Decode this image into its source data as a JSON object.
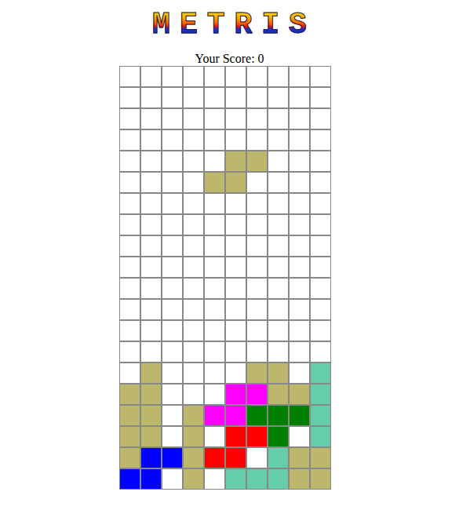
{
  "logo": {
    "title": "METRIS"
  },
  "score": {
    "label": "Your Score:",
    "value": "0"
  },
  "board": {
    "rows": [
      [
        null,
        null,
        null,
        null,
        null,
        null,
        null,
        null,
        null,
        null
      ],
      [
        null,
        null,
        null,
        null,
        null,
        null,
        null,
        null,
        null,
        null
      ],
      [
        null,
        null,
        null,
        null,
        null,
        null,
        null,
        null,
        null,
        null
      ],
      [
        null,
        null,
        null,
        null,
        null,
        null,
        null,
        null,
        null,
        null
      ],
      [
        null,
        null,
        null,
        null,
        null,
        "#bdb76b",
        "#bdb76b",
        null,
        null,
        null
      ],
      [
        null,
        null,
        null,
        null,
        "#bdb76b",
        "#bdb76b",
        null,
        null,
        null,
        null
      ],
      [
        null,
        null,
        null,
        null,
        null,
        null,
        null,
        null,
        null,
        null
      ],
      [
        null,
        null,
        null,
        null,
        null,
        null,
        null,
        null,
        null,
        null
      ],
      [
        null,
        null,
        null,
        null,
        null,
        null,
        null,
        null,
        null,
        null
      ],
      [
        null,
        null,
        null,
        null,
        null,
        null,
        null,
        null,
        null,
        null
      ],
      [
        null,
        null,
        null,
        null,
        null,
        null,
        null,
        null,
        null,
        null
      ],
      [
        null,
        null,
        null,
        null,
        null,
        null,
        null,
        null,
        null,
        null
      ],
      [
        null,
        null,
        null,
        null,
        null,
        null,
        null,
        null,
        null,
        null
      ],
      [
        null,
        null,
        null,
        null,
        null,
        null,
        null,
        null,
        null,
        null
      ],
      [
        null,
        "#bdb76b",
        null,
        null,
        null,
        null,
        "#bdb76b",
        "#bdb76b",
        null,
        "#66cdaa"
      ],
      [
        "#bdb76b",
        "#bdb76b",
        null,
        null,
        null,
        "#ff00ff",
        "#ff00ff",
        "#bdb76b",
        "#bdb76b",
        "#66cdaa"
      ],
      [
        "#bdb76b",
        "#bdb76b",
        null,
        "#bdb76b",
        "#ff00ff",
        "#ff00ff",
        "#008000",
        "#008000",
        "#008000",
        "#66cdaa"
      ],
      [
        "#bdb76b",
        "#bdb76b",
        null,
        "#bdb76b",
        null,
        "#ff0000",
        "#ff0000",
        "#008000",
        null,
        "#66cdaa"
      ],
      [
        "#bdb76b",
        "#0000ff",
        "#0000ff",
        "#bdb76b",
        "#ff0000",
        "#ff0000",
        null,
        "#66cdaa",
        "#bdb76b",
        "#bdb76b"
      ],
      [
        "#0000ff",
        "#0000ff",
        null,
        "#bdb76b",
        null,
        "#66cdaa",
        "#66cdaa",
        "#66cdaa",
        "#bdb76b",
        "#bdb76b"
      ]
    ]
  }
}
